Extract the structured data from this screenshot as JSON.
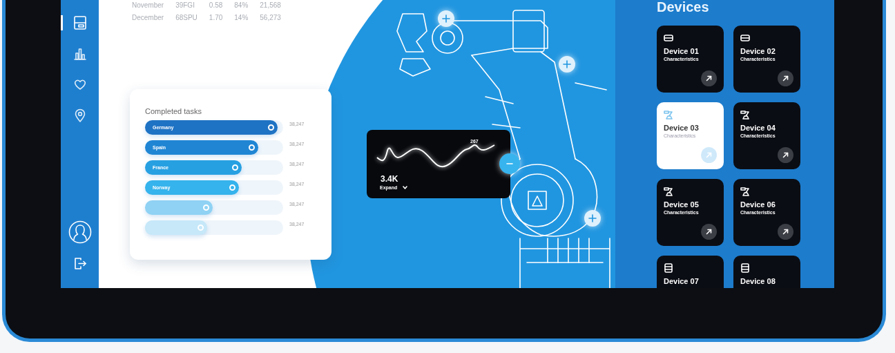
{
  "sidebar": {
    "items": [
      {
        "kind": "layout",
        "selected": true
      },
      {
        "kind": "chart",
        "selected": false
      },
      {
        "kind": "heart",
        "selected": false
      },
      {
        "kind": "pin",
        "selected": false
      }
    ]
  },
  "table": {
    "rows": [
      [
        "November",
        "39FGI",
        "0.58",
        "84%",
        "21,568"
      ],
      [
        "December",
        "68SPU",
        "1.70",
        "14%",
        "56,273"
      ]
    ]
  },
  "completed_tasks": {
    "title": "Completed tasks",
    "bars": [
      {
        "label": "Germany",
        "value": "38,247",
        "level": 0.96,
        "color": "#1f73c4"
      },
      {
        "label": "Spain",
        "value": "38,247",
        "level": 0.82,
        "color": "#2086d4"
      },
      {
        "label": "France",
        "value": "38,247",
        "level": 0.7,
        "color": "#27a0e2"
      },
      {
        "label": "Norway",
        "value": "38,247",
        "level": 0.68,
        "color": "#35b3ec"
      },
      {
        "value": "38,247",
        "level": 0.49,
        "color": "#8fd2f4"
      },
      {
        "value": "38,247",
        "level": 0.45,
        "color": "#c6e8f9"
      }
    ]
  },
  "activity_card": {
    "peak_label": "267",
    "value": "3.4K",
    "expand": "Expand"
  },
  "devices": {
    "title": "Devices",
    "items": [
      {
        "name": "Device 01",
        "subtitle": "Characteristics",
        "kind": "box",
        "selected": false
      },
      {
        "name": "Device 02",
        "subtitle": "Characteristics",
        "kind": "box",
        "selected": false
      },
      {
        "name": "Device 03",
        "subtitle": "Characteristics",
        "kind": "arm",
        "selected": true
      },
      {
        "name": "Device 04",
        "subtitle": "Characteristics",
        "kind": "arm",
        "selected": false
      },
      {
        "name": "Device 05",
        "subtitle": "Characteristics",
        "kind": "arm",
        "selected": false
      },
      {
        "name": "Device 06",
        "subtitle": "Characteristics",
        "kind": "arm",
        "selected": false
      },
      {
        "name": "Device 07",
        "kind": "stack",
        "selected": false
      },
      {
        "name": "Device 08",
        "kind": "stack",
        "selected": false
      }
    ]
  }
}
